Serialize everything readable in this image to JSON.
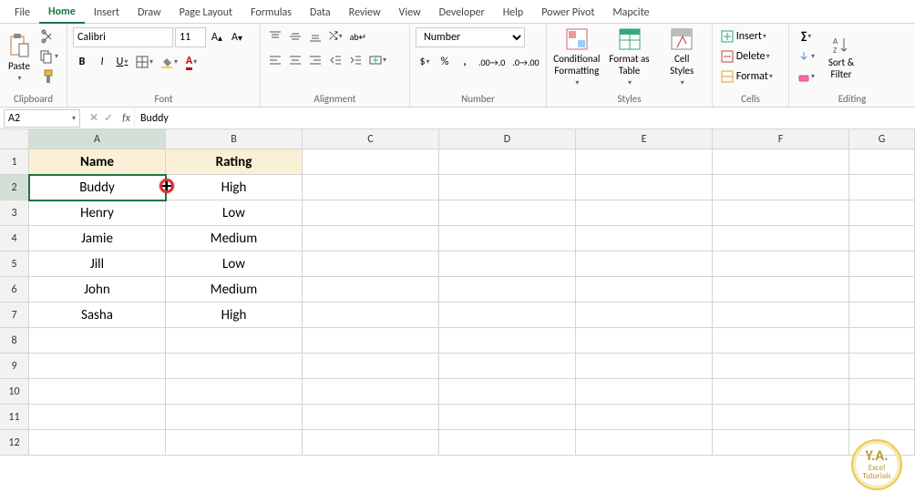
{
  "tabs": [
    "File",
    "Home",
    "Insert",
    "Draw",
    "Page Layout",
    "Formulas",
    "Data",
    "Review",
    "View",
    "Developer",
    "Help",
    "Power Pivot",
    "Mapcite"
  ],
  "active_tab": "Home",
  "clipboard": {
    "paste": "Paste",
    "label": "Clipboard"
  },
  "font": {
    "name": "Calibri",
    "size": "11",
    "bold": "B",
    "italic": "I",
    "underline": "U",
    "label": "Font"
  },
  "alignment": {
    "label": "Alignment"
  },
  "number": {
    "format": "Number",
    "label": "Number"
  },
  "styles": {
    "conditional": "Conditional\nFormatting",
    "formatas": "Format as\nTable",
    "cellstyles": "Cell\nStyles",
    "label": "Styles"
  },
  "cells": {
    "insert": "Insert",
    "delete": "Delete",
    "format": "Format",
    "label": "Cells"
  },
  "editing": {
    "sort": "Sort &\nFilter",
    "label": "Editing"
  },
  "namebox": "A2",
  "formula": "Buddy",
  "columns": [
    "A",
    "B",
    "C",
    "D",
    "E",
    "F",
    "G"
  ],
  "rows": [
    "1",
    "2",
    "3",
    "4",
    "5",
    "6",
    "7",
    "8",
    "9",
    "10",
    "11",
    "12"
  ],
  "sheet": {
    "headers": [
      "Name",
      "Rating"
    ],
    "data": [
      [
        "Buddy",
        "High"
      ],
      [
        "Henry",
        "Low"
      ],
      [
        "Jamie",
        "Medium"
      ],
      [
        "Jill",
        "Low"
      ],
      [
        "John",
        "Medium"
      ],
      [
        "Sasha",
        "High"
      ]
    ]
  },
  "selected_cell": "A2",
  "watermark": {
    "top": "Y.A.",
    "bottom1": "Excel",
    "bottom2": "Tutorials"
  }
}
